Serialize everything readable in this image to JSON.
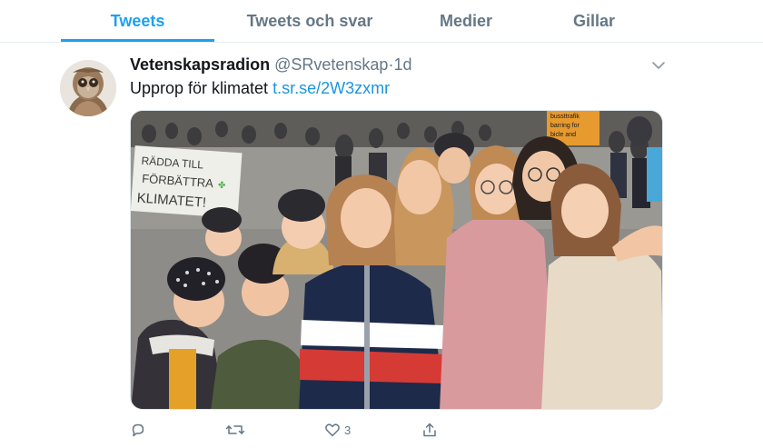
{
  "tabs": {
    "tweets": "Tweets",
    "tweets_replies": "Tweets och svar",
    "media": "Medier",
    "likes": "Gillar"
  },
  "tweet": {
    "display_name": "Vetenskapsradion",
    "handle": "@SRvetenskap",
    "separator": "·",
    "time": "1d",
    "text": "Upprop för klimatet",
    "link": "t.sr.se/2W3zxmr",
    "like_count": "3",
    "photo": {
      "sign_text_1": "RÄDDA TILL",
      "sign_text_2": "FÖRBÄTTRA",
      "sign_text_3": "KLIMATET!",
      "background_sign_1": "bussttrafik",
      "background_sign_2": "barring for",
      "background_sign_3": "bicle and"
    }
  },
  "colors": {
    "accent": "#1da1f2",
    "link": "#1b95e0",
    "secondary_text": "#657786",
    "divider": "#e6ecf0"
  },
  "icons": {
    "reply": "reply-icon",
    "retweet": "retweet-icon",
    "like": "heart-icon",
    "share": "share-icon",
    "menu": "chevron-down-icon",
    "avatar": "owl-avatar"
  }
}
